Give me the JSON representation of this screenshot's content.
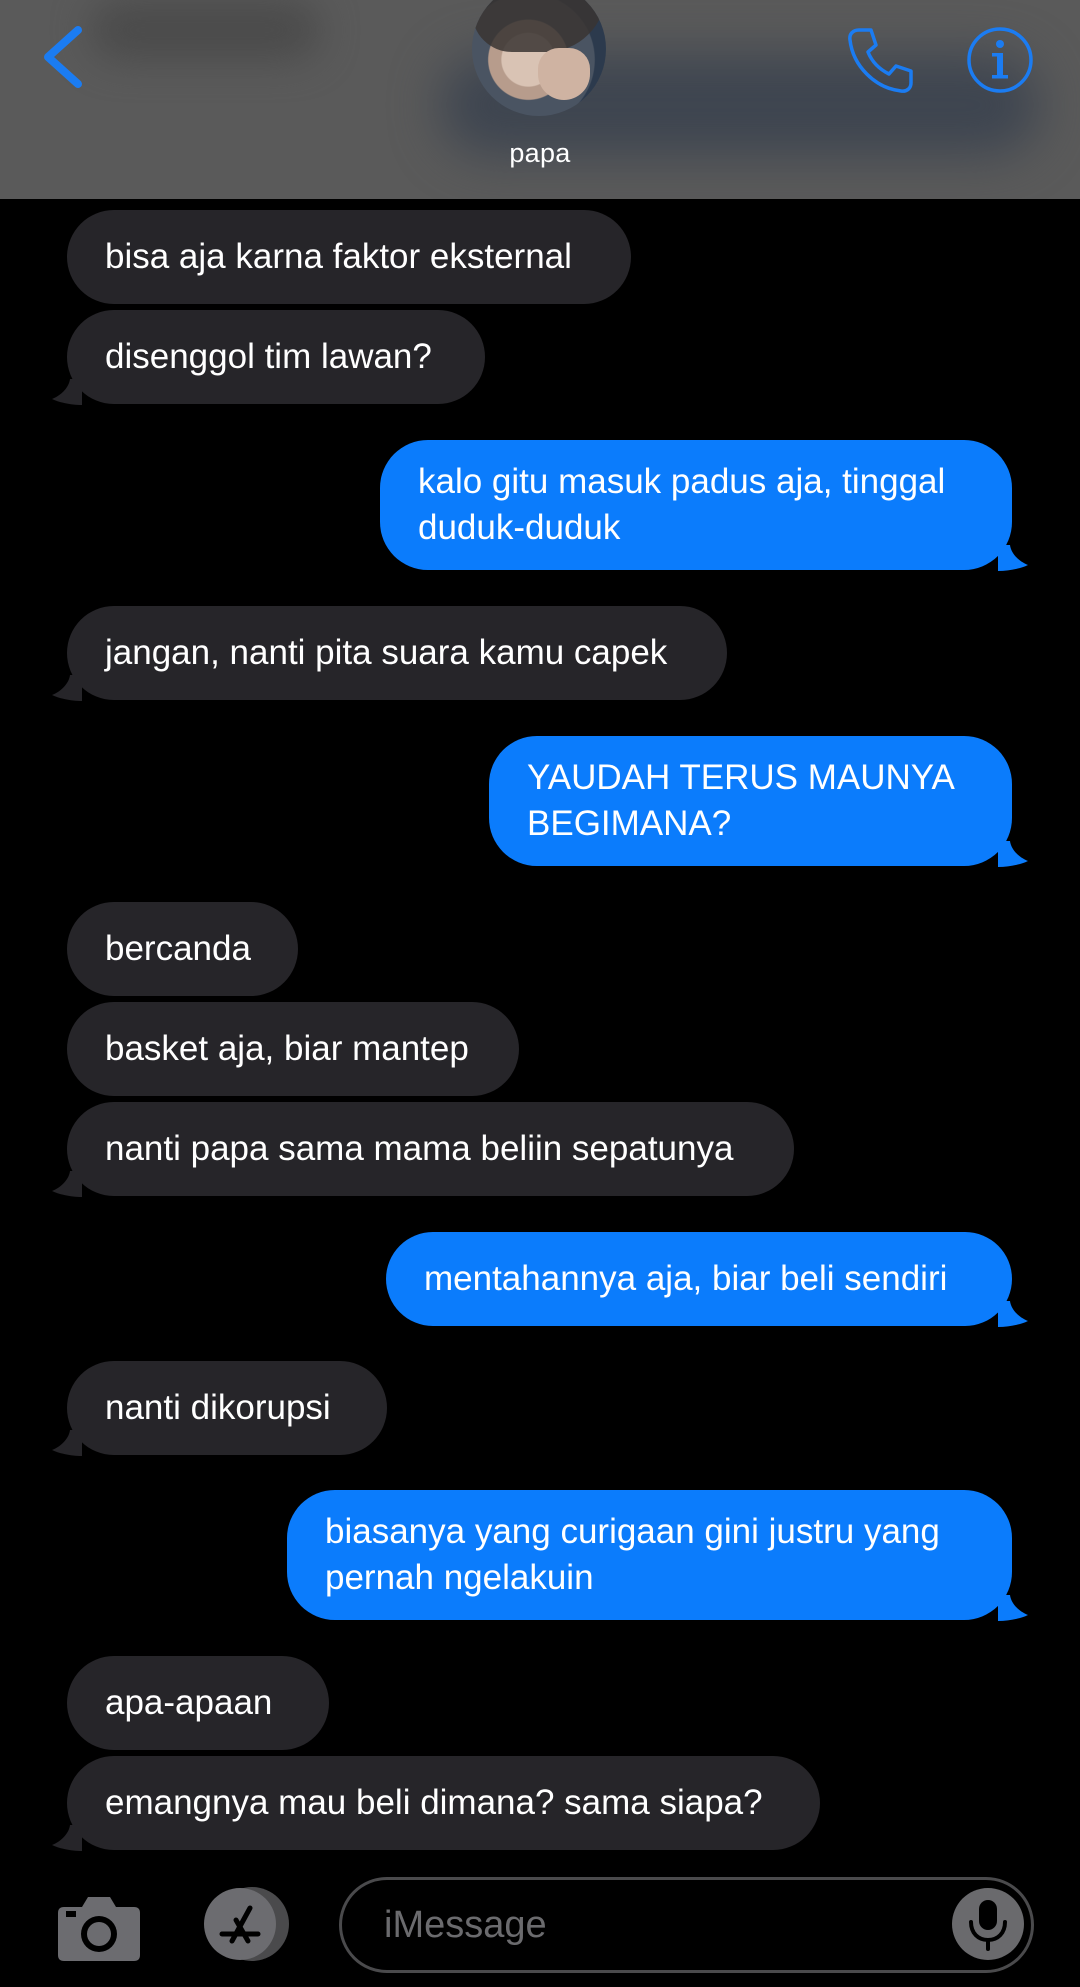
{
  "header": {
    "contact_name": "papa",
    "back_icon": "chevron-left-icon",
    "call_icon": "phone-icon",
    "info_icon": "info-icon",
    "accent_color": "#1b7cf2"
  },
  "messages": [
    {
      "dir": "in",
      "text": "bisa aja karna faktor eksternal"
    },
    {
      "dir": "in",
      "text": "disenggol tim lawan?"
    },
    {
      "dir": "out",
      "text": "kalo gitu masuk padus aja, tinggal\nduduk-duduk"
    },
    {
      "dir": "in",
      "text": "jangan, nanti pita suara kamu capek"
    },
    {
      "dir": "out",
      "text": "YAUDAH TERUS MAUNYA\nBEGIMANA?"
    },
    {
      "dir": "in",
      "text": "bercanda"
    },
    {
      "dir": "in",
      "text": "basket aja, biar mantep"
    },
    {
      "dir": "in",
      "text": "nanti papa sama mama beliin sepatunya"
    },
    {
      "dir": "out",
      "text": "mentahannya aja, biar beli sendiri"
    },
    {
      "dir": "in",
      "text": "nanti dikorupsi"
    },
    {
      "dir": "out",
      "text": "biasanya yang curigaan gini justru yang\npernah ngelakuin"
    },
    {
      "dir": "in",
      "text": "apa-apaan"
    },
    {
      "dir": "in",
      "text": "emangnya mau beli dimana? sama siapa?"
    }
  ],
  "colors": {
    "incoming_bubble": "#262529",
    "outgoing_bubble": "#0b7cfc"
  },
  "composer": {
    "placeholder": "iMessage",
    "camera_icon": "camera-icon",
    "apps_icon": "app-store-icon",
    "mic_icon": "microphone-icon"
  }
}
